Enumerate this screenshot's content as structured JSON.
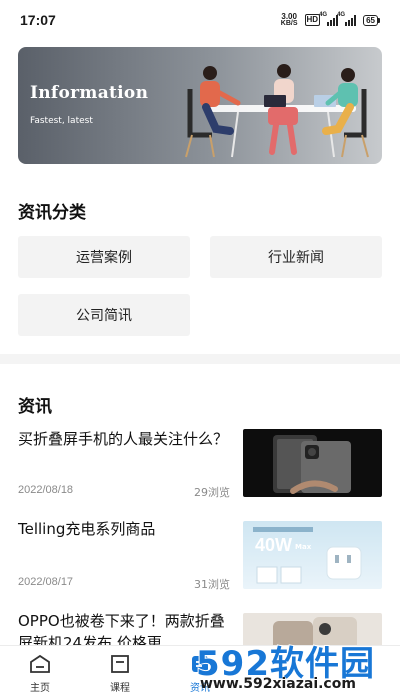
{
  "status_bar": {
    "time": "17:07",
    "net_speed": "3.00",
    "net_unit": "KB/S",
    "hd": "HD",
    "signal1_label": "4G",
    "signal2_label": "4G",
    "battery": "65"
  },
  "banner": {
    "title": "Information",
    "subtitle": "Fastest, latest"
  },
  "categories": {
    "title": "资讯分类",
    "items": [
      "运营案例",
      "行业新闻",
      "公司简讯"
    ]
  },
  "news": {
    "title": "资讯",
    "items": [
      {
        "title": "买折叠屏手机的人最关注什么？",
        "date": "2022/08/18",
        "views": "29浏览"
      },
      {
        "title": "Telling充电系列商品",
        "date": "2022/08/17",
        "views": "31浏览",
        "thumb_text": "40W",
        "thumb_sub": "Max"
      },
      {
        "title": "OPPO也被卷下来了！两款折叠屏新机24发布,价格更",
        "date": "",
        "views": ""
      }
    ]
  },
  "tabbar": {
    "items": [
      {
        "label": "主页",
        "icon": "home-icon"
      },
      {
        "label": "课程",
        "icon": "course-icon"
      },
      {
        "label": "资讯",
        "icon": "info-icon"
      }
    ]
  },
  "watermark": {
    "brand": "592软件园",
    "url": "www.592xiazai.com"
  },
  "colors": {
    "accent": "#1877d6",
    "banner_dark": "#5a6069",
    "banner_light": "#c7cacd"
  }
}
